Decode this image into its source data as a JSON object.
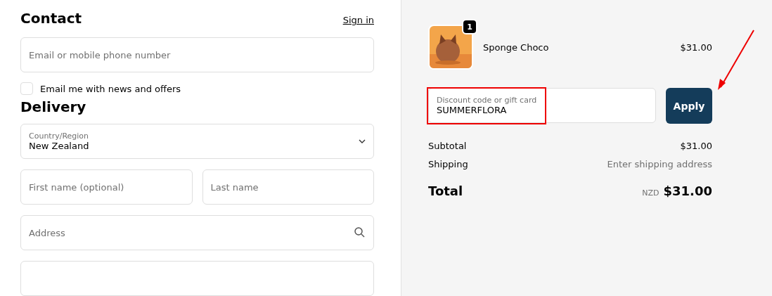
{
  "contact": {
    "heading": "Contact",
    "sign_in": "Sign in",
    "email": {
      "placeholder": "Email or mobile phone number"
    },
    "newsletter": {
      "label": "Email me with news and offers",
      "checked": false
    }
  },
  "delivery": {
    "heading": "Delivery",
    "country": {
      "label": "Country/Region",
      "value": "New Zealand"
    },
    "first_name": {
      "placeholder": "First name (optional)"
    },
    "last_name": {
      "placeholder": "Last name"
    },
    "address": {
      "placeholder": "Address"
    }
  },
  "order": {
    "items": [
      {
        "name": "Sponge Choco",
        "quantity": "1",
        "price": "$31.00"
      }
    ],
    "discount": {
      "label": "Discount code or gift card",
      "value": "SUMMERFLORA",
      "highlighted": true
    },
    "apply_button": "Apply",
    "summary": [
      {
        "label": "Subtotal",
        "value": "$31.00",
        "kind": "amount"
      },
      {
        "label": "Shipping",
        "value": "Enter shipping address",
        "kind": "note"
      }
    ],
    "total": {
      "label": "Total",
      "currency": "NZD",
      "value": "$31.00"
    }
  }
}
